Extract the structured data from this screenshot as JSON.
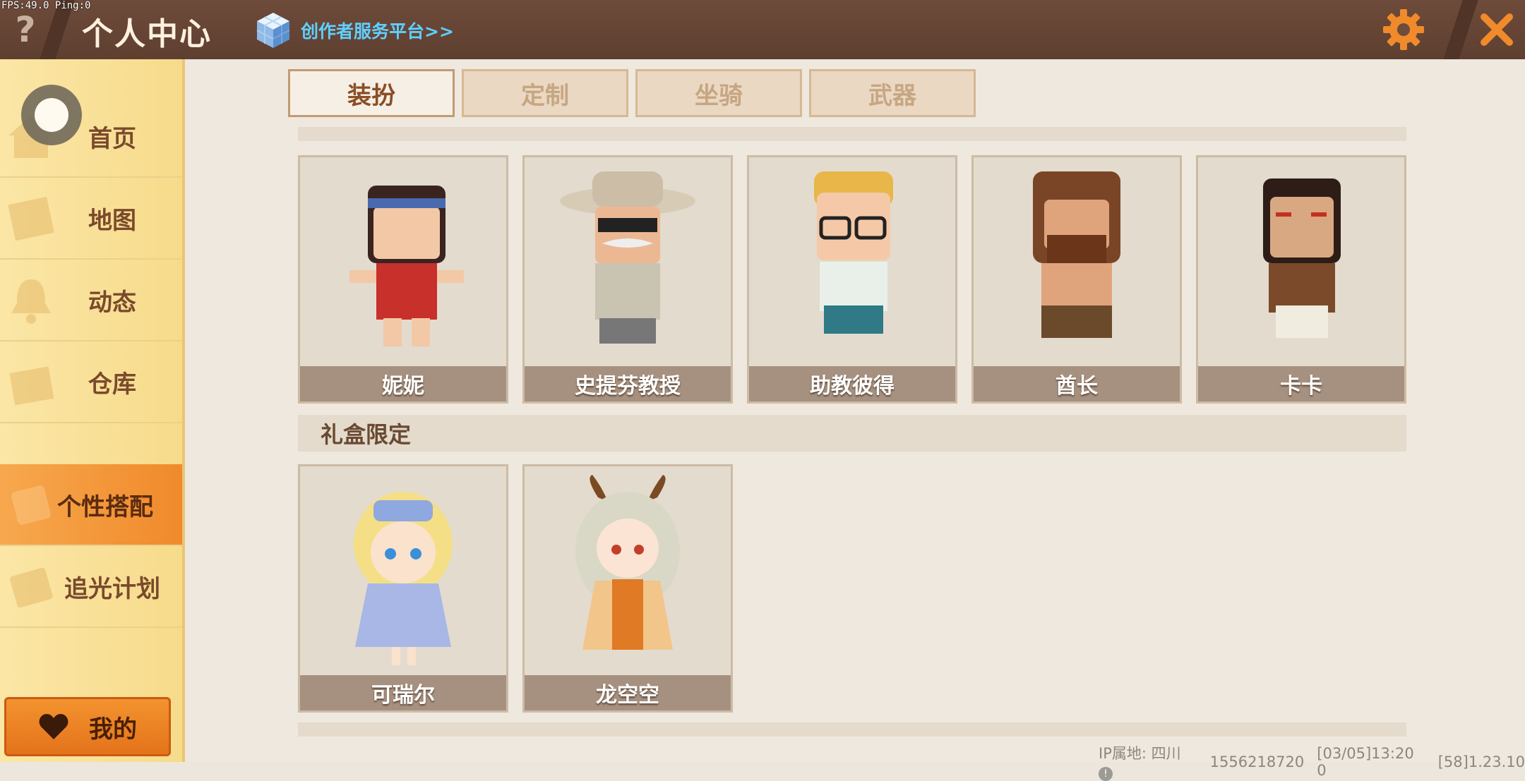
{
  "debug": {
    "fps_text": "FPS:49.0  Ping:0"
  },
  "header": {
    "help_label": "?",
    "title": "个人中心",
    "creator_link": "创作者服务平台>>"
  },
  "sidebar": {
    "items": [
      {
        "label": "首页",
        "icon": "house-icon"
      },
      {
        "label": "地图",
        "icon": "map-icon"
      },
      {
        "label": "动态",
        "icon": "bell-icon"
      },
      {
        "label": "仓库",
        "icon": "warehouse-icon"
      },
      {
        "label": "个性搭配",
        "icon": "outfit-icon",
        "active": true
      },
      {
        "label": "追光计划",
        "icon": "star-icon"
      }
    ],
    "mine_label": "我的"
  },
  "tabs": [
    {
      "label": "装扮",
      "active": true
    },
    {
      "label": "定制"
    },
    {
      "label": "坐骑"
    },
    {
      "label": "武器"
    }
  ],
  "sections": [
    {
      "title": "",
      "cards": [
        {
          "name": "妮妮"
        },
        {
          "name": "史提芬教授"
        },
        {
          "name": "助教彼得"
        },
        {
          "name": "酋长"
        },
        {
          "name": "卡卡"
        }
      ]
    },
    {
      "title": "礼盒限定",
      "cards": [
        {
          "name": "可瑞尔"
        },
        {
          "name": "龙空空"
        }
      ]
    }
  ],
  "footer": {
    "ip_label": "IP属地: 四川",
    "uid": "1556218720",
    "time": "[03/05]13:20 0",
    "version": "[58]1.23.10"
  },
  "colors": {
    "accent": "#f08a2b",
    "topbar": "#6e4b3a",
    "sidebar": "#f7db8b",
    "link": "#5fd0ff"
  }
}
